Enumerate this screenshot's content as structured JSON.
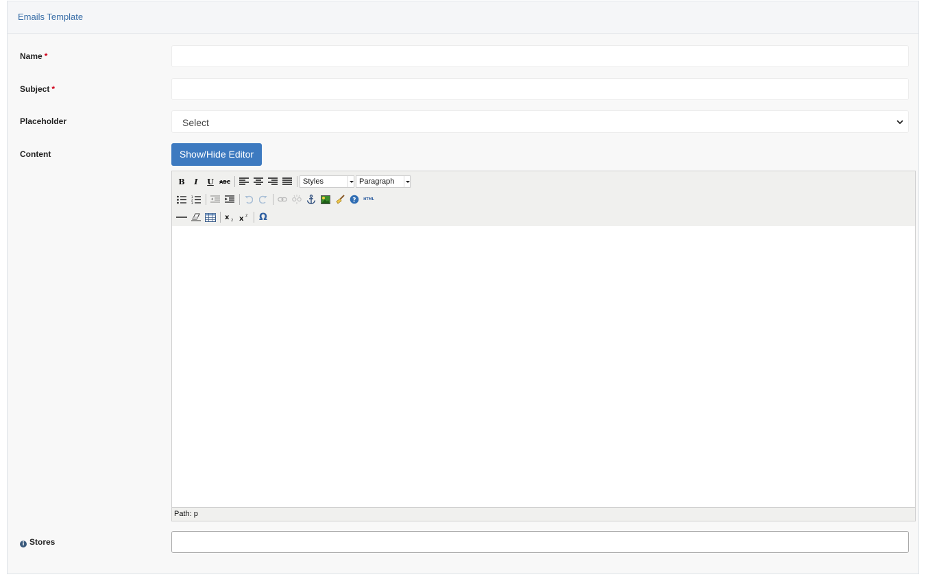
{
  "panel": {
    "title": "Emails Template"
  },
  "form": {
    "name": {
      "label": "Name",
      "required_mark": "*",
      "value": ""
    },
    "subject": {
      "label": "Subject",
      "required_mark": "*",
      "value": ""
    },
    "placeholder": {
      "label": "Placeholder",
      "selected": "Select"
    },
    "content": {
      "label": "Content",
      "toggle_button": "Show/Hide Editor"
    },
    "stores": {
      "label": "Stores",
      "value": ""
    }
  },
  "editor": {
    "styles_dropdown": "Styles",
    "format_dropdown": "Paragraph",
    "status_path": "Path: p",
    "toolbar_row1": [
      "bold-icon",
      "italic-icon",
      "underline-icon",
      "strikethrough-icon",
      "align-left-icon",
      "align-center-icon",
      "align-right-icon",
      "align-justify-icon"
    ],
    "toolbar_row2": [
      "bullet-list-icon",
      "numbered-list-icon",
      "outdent-icon",
      "indent-icon",
      "undo-icon",
      "redo-icon",
      "link-icon",
      "unlink-icon",
      "anchor-icon",
      "image-icon",
      "cleanup-icon",
      "help-icon",
      "html-icon"
    ],
    "toolbar_row3": [
      "horizontal-rule-icon",
      "remove-format-icon",
      "table-icon",
      "subscript-icon",
      "superscript-icon",
      "special-char-icon"
    ],
    "html_icon_text": "HTML",
    "omega_char": "Ω"
  },
  "colors": {
    "accent": "#3d7ac0",
    "title": "#3a6fa8",
    "required": "#d0021b"
  }
}
